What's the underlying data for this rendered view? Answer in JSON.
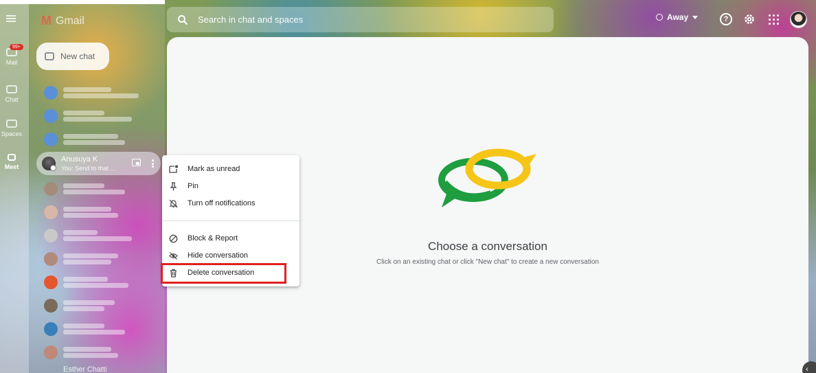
{
  "app": {
    "logo_text": "Gmail"
  },
  "rail": {
    "items": [
      {
        "label": "Mail",
        "badge": "99+"
      },
      {
        "label": "Chat"
      },
      {
        "label": "Spaces"
      },
      {
        "label": "Meet"
      }
    ]
  },
  "chatlist": {
    "new_chat_label": "New chat",
    "active_chat": {
      "name": "Anusuya K",
      "preview": "You: Send to that ..."
    },
    "bottom_name": "Esther Chatti"
  },
  "search": {
    "placeholder": "Search in chat and spaces"
  },
  "status": {
    "label": "Away"
  },
  "icons": {
    "help": "?"
  },
  "context_menu": {
    "items": [
      {
        "label": "Mark as unread",
        "icon": "mark-unread-icon"
      },
      {
        "label": "Pin",
        "icon": "pin-icon"
      },
      {
        "label": "Turn off notifications",
        "icon": "notifications-off-icon"
      },
      {
        "label": "Block & Report",
        "icon": "block-icon"
      },
      {
        "label": "Hide conversation",
        "icon": "hide-icon"
      },
      {
        "label": "Delete conversation",
        "icon": "trash-icon"
      }
    ],
    "highlight_color": "#e02020"
  },
  "main": {
    "title": "Choose a conversation",
    "subtitle": "Click on an existing chat or click \"New chat\" to create a new conversation"
  },
  "colors": {
    "green": "#1e9e3e",
    "yellow": "#f5c518",
    "accent_red": "#e02020"
  }
}
